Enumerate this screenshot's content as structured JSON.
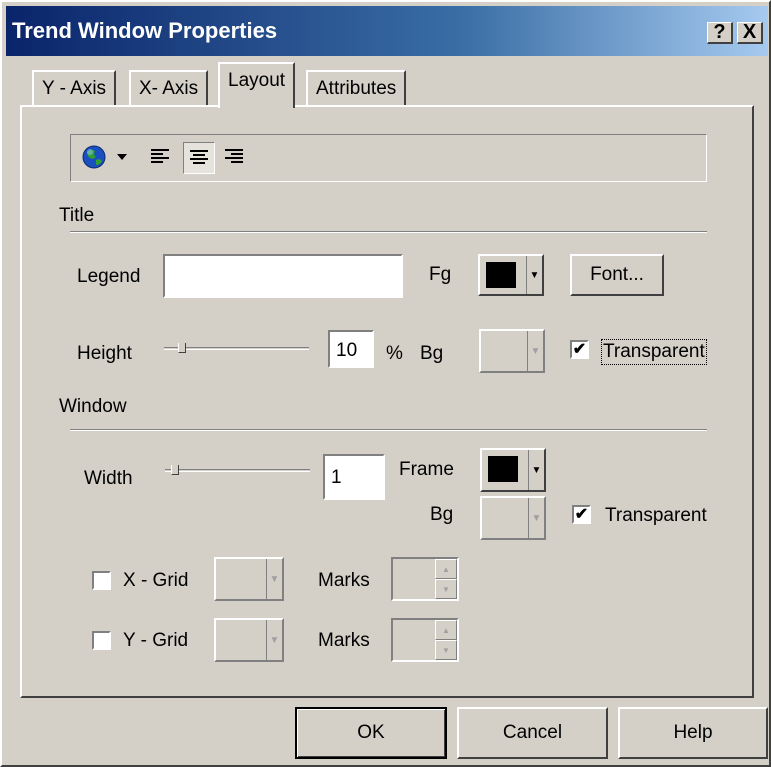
{
  "window": {
    "title": "Trend Window Properties",
    "help_button": "?",
    "close_button": "X"
  },
  "tabs": [
    {
      "label": "Y - Axis",
      "active": false
    },
    {
      "label": "X- Axis",
      "active": false
    },
    {
      "label": "Layout",
      "active": true
    },
    {
      "label": "Attributes",
      "active": false
    }
  ],
  "toolbar": {
    "items": [
      "globe-icon",
      "dropdown-arrow",
      "align-left-icon",
      "align-center-icon",
      "align-right-icon"
    ],
    "pressed": "align-center-icon"
  },
  "title_section": {
    "heading": "Title",
    "legend_label": "Legend",
    "legend_value": "",
    "fg_label": "Fg",
    "fg_color": "#000000",
    "font_button": "Font...",
    "height_label": "Height",
    "height_value": "10",
    "height_unit": "%",
    "bg_label": "Bg",
    "transparent_label": "Transparent",
    "transparent_checked": true
  },
  "window_section": {
    "heading": "Window",
    "width_label": "Width",
    "width_value": "1",
    "frame_label": "Frame",
    "frame_color": "#000000",
    "bg_label": "Bg",
    "transparent_label": "Transparent",
    "transparent_checked": true,
    "xgrid_label": "X - Grid",
    "xgrid_checked": false,
    "ygrid_label": "Y - Grid",
    "ygrid_checked": false,
    "marks_label": "Marks"
  },
  "buttons": {
    "ok": "OK",
    "cancel": "Cancel",
    "help": "Help"
  },
  "colors": {
    "face": "#d4d0c8",
    "titlebar_start": "#0a246a",
    "titlebar_end": "#a6caf0"
  }
}
